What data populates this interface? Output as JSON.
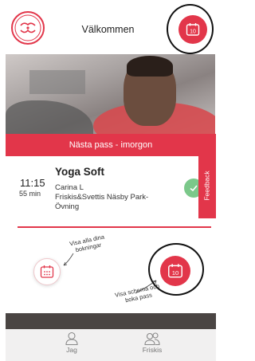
{
  "header": {
    "title": "Välkommen",
    "logo_text": "Friskis&Svettis",
    "calendar_badge": "10"
  },
  "banner": {
    "label": "Nästa pass - imorgon"
  },
  "next_class": {
    "time": "11:15",
    "duration": "55 min",
    "name": "Yoga Soft",
    "instructor": "Carina L",
    "location_line1": "Friskis&Svettis Näsby Park-",
    "location_line2": "Övning"
  },
  "feedback": {
    "label": "Feedback"
  },
  "onboarding": {
    "hint_bookings": "Visa alla dina bokningar",
    "hint_schedule": "Visa schema och boka pass",
    "calendar_badge": "10"
  },
  "bottom_nav": [
    {
      "label": "Jag",
      "icon": "person-icon"
    },
    {
      "label": "Friskis",
      "icon": "group-icon"
    }
  ],
  "colors": {
    "accent": "#e2364a",
    "success": "#7bc88a"
  }
}
